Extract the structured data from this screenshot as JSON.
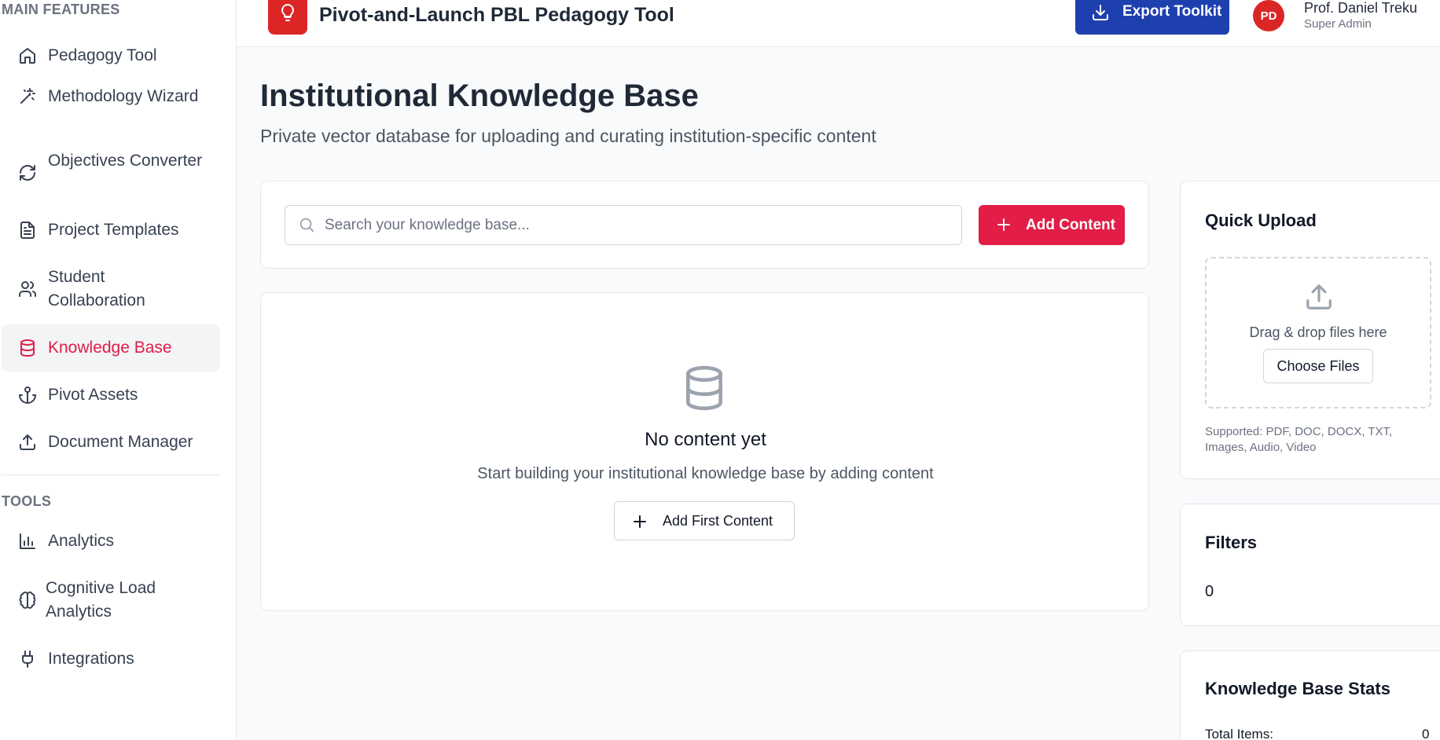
{
  "sidebar": {
    "sections": [
      {
        "label": "MAIN FEATURES",
        "items": [
          {
            "label": "Pedagogy Tool",
            "icon": "home-icon"
          },
          {
            "label": "Methodology Wizard",
            "icon": "magic-wand-icon"
          },
          {
            "label": "Objectives Converter",
            "icon": "refresh-icon"
          },
          {
            "label": "Project Templates",
            "icon": "file-text-icon"
          },
          {
            "label": "Student Collaboration",
            "icon": "users-icon"
          },
          {
            "label": "Knowledge Base",
            "icon": "database-icon",
            "active": true
          },
          {
            "label": "Pivot Assets",
            "icon": "anchor-icon"
          },
          {
            "label": "Document Manager",
            "icon": "upload-icon"
          }
        ]
      },
      {
        "label": "TOOLS",
        "items": [
          {
            "label": "Analytics",
            "icon": "bar-chart-icon"
          },
          {
            "label": "Cognitive Load Analytics",
            "icon": "brain-icon"
          },
          {
            "label": "Integrations",
            "icon": "plug-icon"
          }
        ]
      }
    ]
  },
  "header": {
    "title": "Pivot-and-Launch PBL Pedagogy Tool",
    "logo_icon": "lightbulb-icon",
    "export_label": "Export Toolkit",
    "user": {
      "initials": "PD",
      "name": "Prof. Daniel Treku",
      "role": "Super Admin"
    }
  },
  "main": {
    "title": "Institutional Knowledge Base",
    "subtitle": "Private vector database for uploading and curating institution-specific content",
    "search": {
      "placeholder": "Search your knowledge base...",
      "value": ""
    },
    "add_content_label": "Add Content",
    "empty": {
      "icon": "database-icon",
      "title": "No content yet",
      "text": "Start building your institutional knowledge base by adding content",
      "button_label": "Add First Content"
    }
  },
  "quick_upload": {
    "title": "Quick Upload",
    "drop_text": "Drag & drop files here",
    "choose_label": "Choose Files",
    "supported": "Supported: PDF, DOC, DOCX, TXT, Images, Audio, Video"
  },
  "filters": {
    "title": "Filters",
    "count": "0"
  },
  "stats": {
    "title": "Knowledge Base Stats",
    "rows": [
      {
        "label": "Total Items:",
        "value": "0"
      }
    ]
  },
  "colors": {
    "accent": "#e11d48",
    "brand": "#dc2626",
    "export": "#1e40af"
  }
}
